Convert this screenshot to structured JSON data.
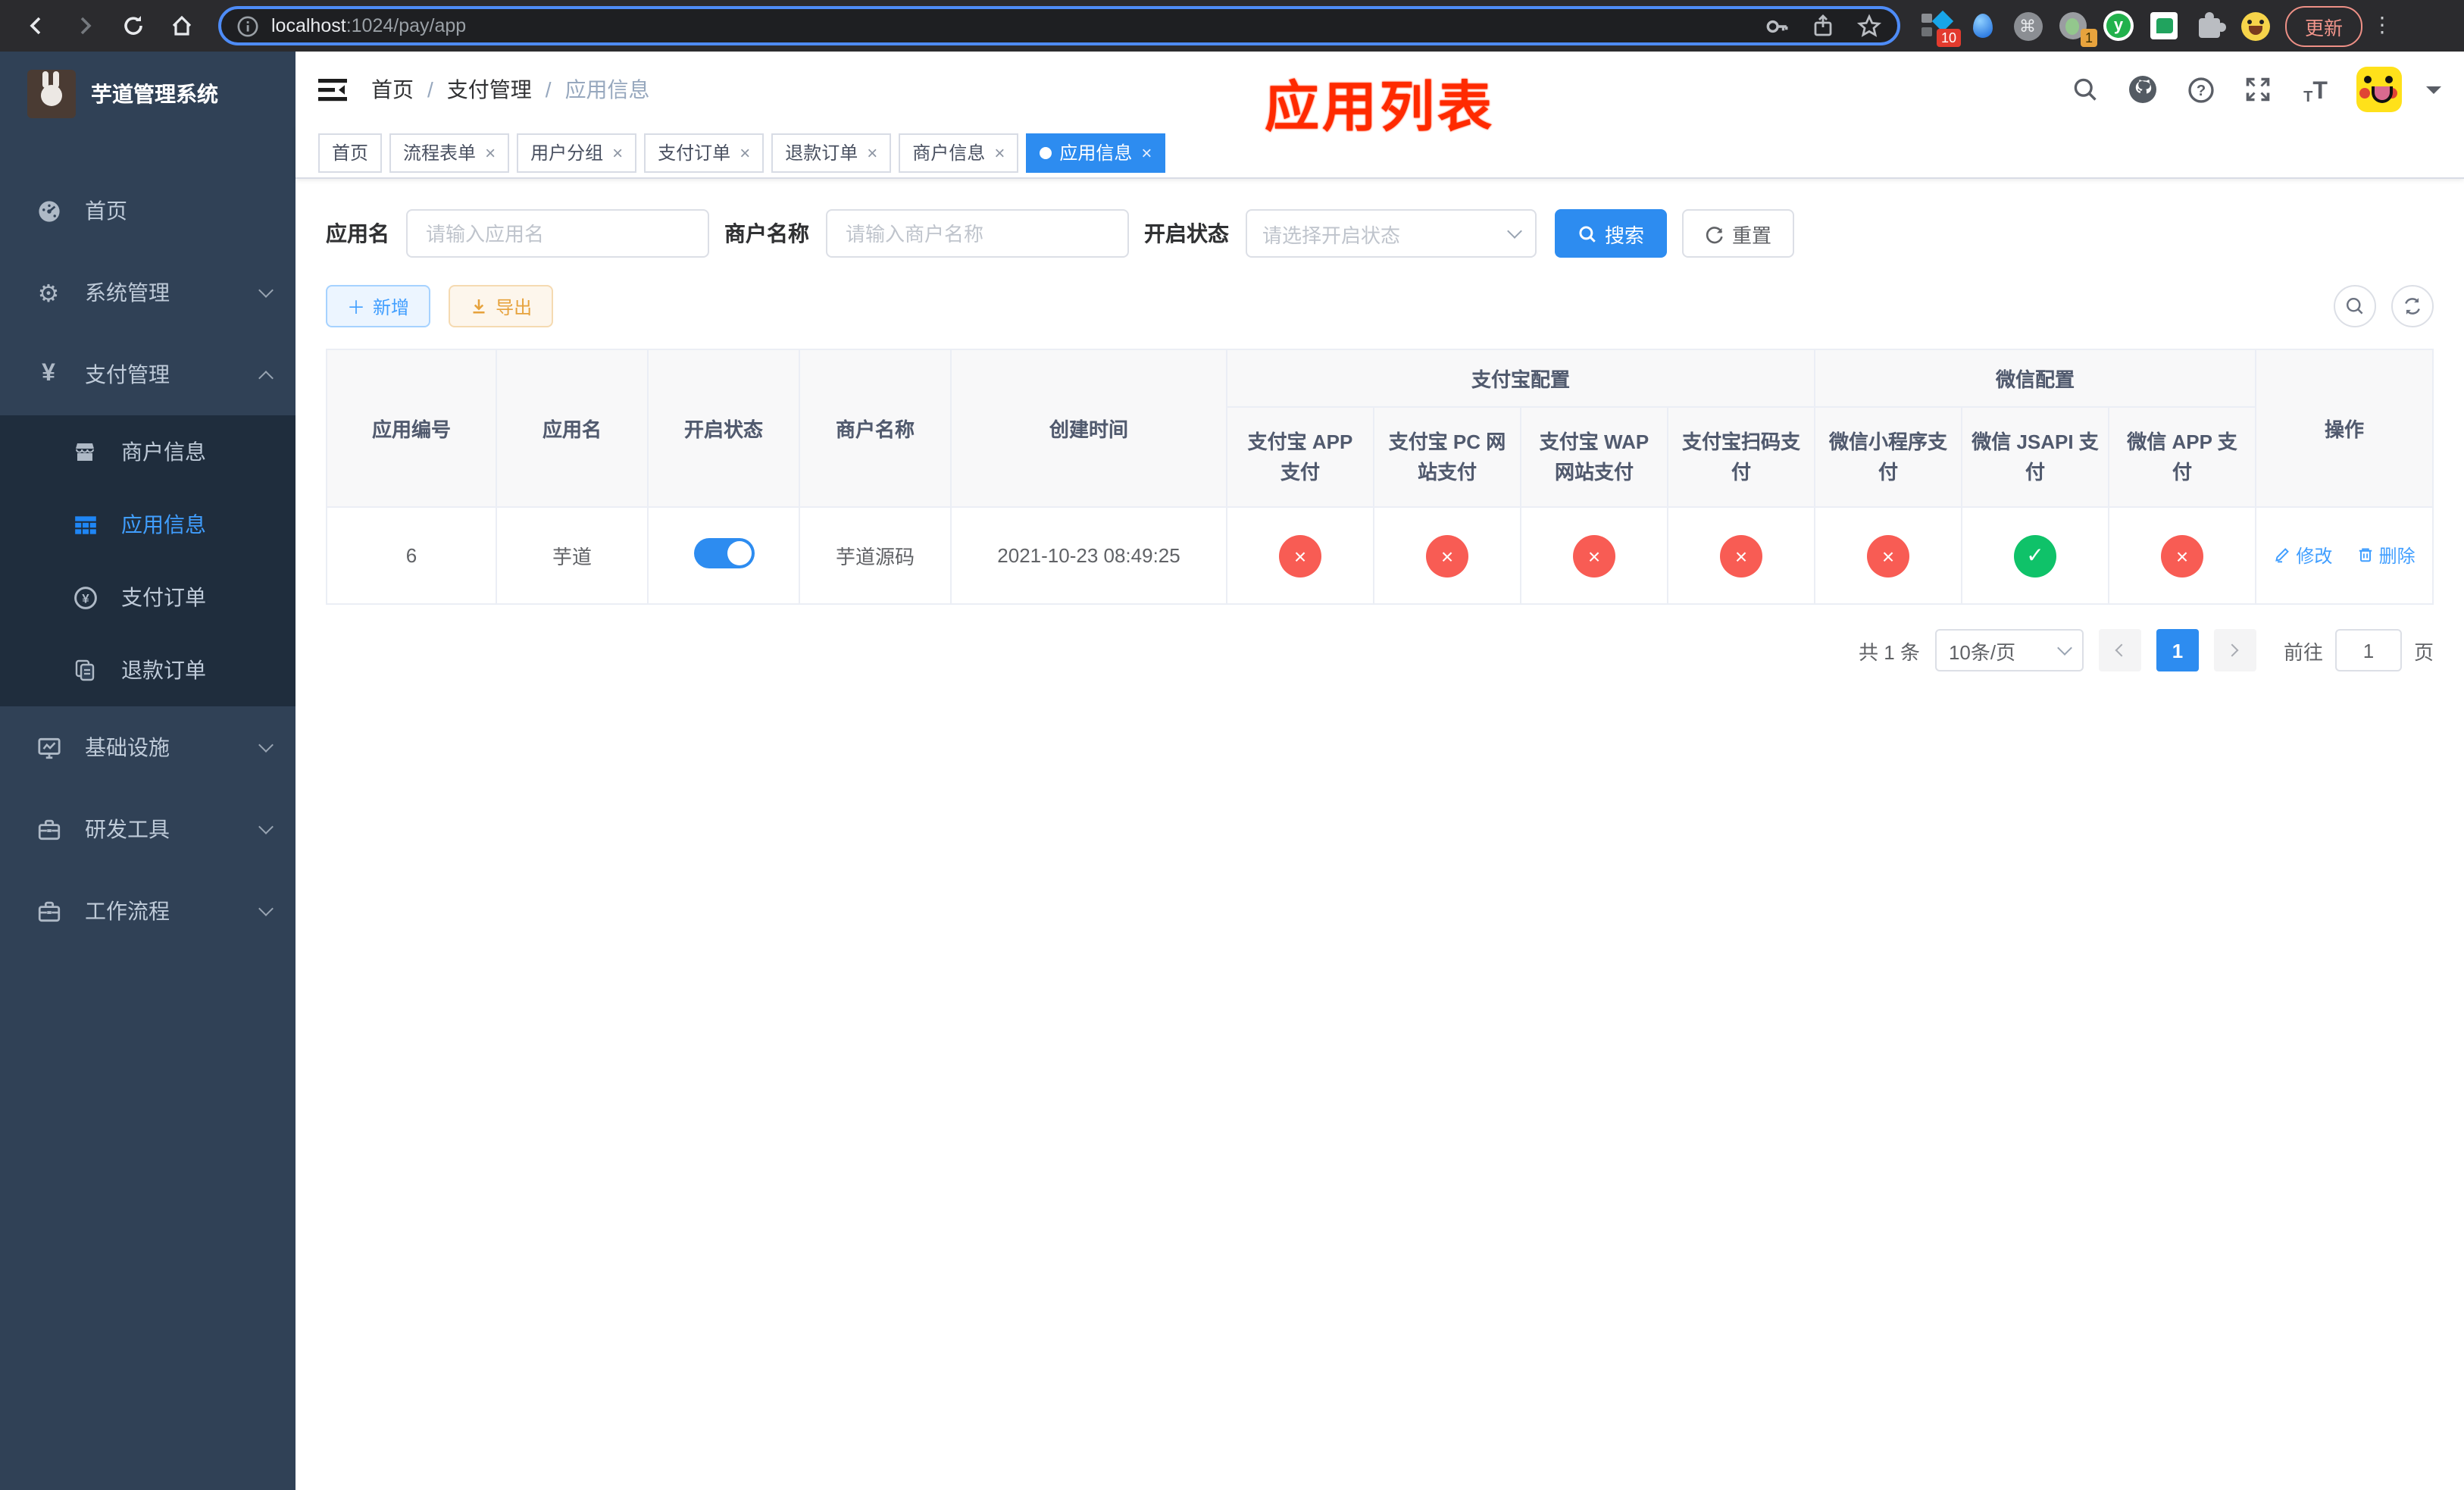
{
  "browser": {
    "url_host": "localhost",
    "url_rest": ":1024/pay/app",
    "ext_badge_1": "10",
    "ext_badge_2": "1",
    "update_label": "更新"
  },
  "sidebar": {
    "title": "芋道管理系统",
    "items": [
      {
        "label": "首页",
        "icon": "dashboard-icon",
        "expandable": false
      },
      {
        "label": "系统管理",
        "icon": "gear-icon",
        "expandable": true
      },
      {
        "label": "支付管理",
        "icon": "yen-icon",
        "expandable": true,
        "expanded": true
      }
    ],
    "submenu": [
      {
        "label": "商户信息",
        "icon": "shop-icon",
        "active": false
      },
      {
        "label": "应用信息",
        "icon": "grid-icon",
        "active": true
      },
      {
        "label": "支付订单",
        "icon": "yen-circle-icon",
        "active": false
      },
      {
        "label": "退款订单",
        "icon": "document-icon",
        "active": false
      }
    ],
    "more_items": [
      {
        "label": "基础设施",
        "icon": "monitor-icon",
        "expandable": true
      },
      {
        "label": "研发工具",
        "icon": "toolbox-icon",
        "expandable": true
      },
      {
        "label": "工作流程",
        "icon": "toolbox-icon",
        "expandable": true
      }
    ]
  },
  "header": {
    "breadcrumb": [
      "首页",
      "支付管理",
      "应用信息"
    ],
    "annotation": "应用列表"
  },
  "tabs": [
    {
      "label": "首页",
      "closable": false,
      "active": false
    },
    {
      "label": "流程表单",
      "closable": true,
      "active": false
    },
    {
      "label": "用户分组",
      "closable": true,
      "active": false
    },
    {
      "label": "支付订单",
      "closable": true,
      "active": false
    },
    {
      "label": "退款订单",
      "closable": true,
      "active": false
    },
    {
      "label": "商户信息",
      "closable": true,
      "active": false
    },
    {
      "label": "应用信息",
      "closable": true,
      "active": true
    }
  ],
  "filters": {
    "app_name_label": "应用名",
    "app_name_placeholder": "请输入应用名",
    "merchant_label": "商户名称",
    "merchant_placeholder": "请输入商户名称",
    "status_label": "开启状态",
    "status_placeholder": "请选择开启状态",
    "search_label": "搜索",
    "reset_label": "重置"
  },
  "toolbar": {
    "add_label": "新增",
    "export_label": "导出"
  },
  "table": {
    "columns": [
      "应用编号",
      "应用名",
      "开启状态",
      "商户名称",
      "创建时间"
    ],
    "groups": [
      {
        "label": "支付宝配置",
        "children": [
          "支付宝 APP 支付",
          "支付宝 PC 网站支付",
          "支付宝 WAP 网站支付",
          "支付宝扫码支付"
        ]
      },
      {
        "label": "微信配置",
        "children": [
          "微信小程序支付",
          "微信 JSAPI 支付",
          "微信 APP 支付"
        ]
      }
    ],
    "op_column": "操作",
    "row": {
      "id": "6",
      "name": "芋道",
      "enabled": true,
      "merchant": "芋道源码",
      "created": "2021-10-23 08:49:25",
      "statuses": [
        {
          "ok": false,
          "glyph": "×"
        },
        {
          "ok": false,
          "glyph": "×"
        },
        {
          "ok": false,
          "glyph": "×"
        },
        {
          "ok": false,
          "glyph": "×"
        },
        {
          "ok": false,
          "glyph": "×"
        },
        {
          "ok": true,
          "glyph": "✓"
        },
        {
          "ok": false,
          "glyph": "×"
        }
      ],
      "edit_label": "修改",
      "delete_label": "删除"
    }
  },
  "pagination": {
    "total": "共 1 条",
    "page_size": "10条/页",
    "page": "1",
    "goto_label": "前往",
    "goto_value": "1",
    "goto_suffix": "页"
  },
  "colors": {
    "primary": "#2d8cf0",
    "menu_active": "#409EFF",
    "danger_circle": "#f85c54",
    "success_circle": "#0fc269",
    "sidebar_bg": "#304156",
    "submenu_bg": "#1f2d3d",
    "annotation_red": "#ff2a00"
  }
}
